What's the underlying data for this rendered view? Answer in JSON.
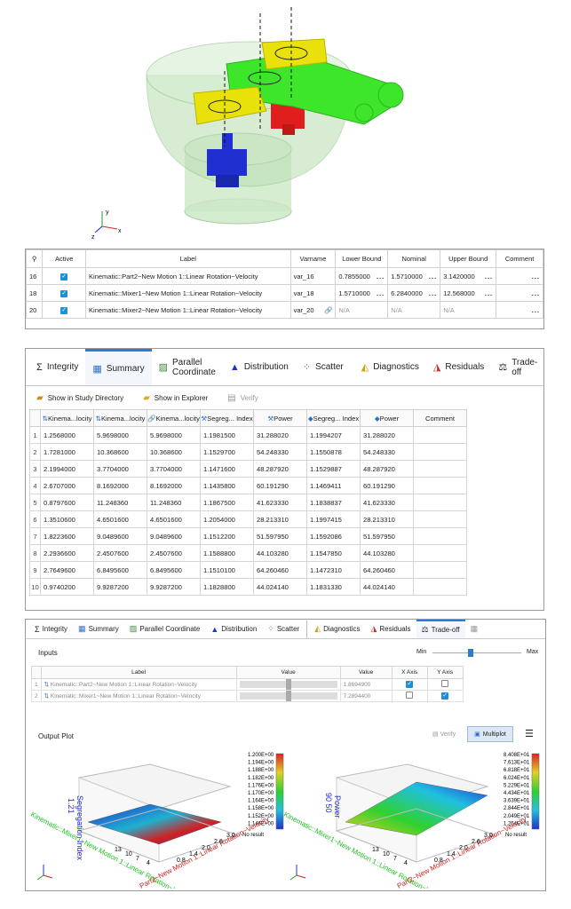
{
  "model": {
    "axis_labels": [
      "y",
      "x",
      "z"
    ],
    "colors": {
      "bowl": "#b9ddb0",
      "arm": "#3ee62b",
      "hub": "#e8e20a",
      "motor_top": "#e01e1e",
      "motor_bottom": "#1f2fd0"
    }
  },
  "vartable": {
    "headers": [
      "",
      "Active",
      "Label",
      "Varname",
      "Lower Bound",
      "Nominal",
      "Upper Bound",
      "Comment"
    ],
    "rows": [
      {
        "id": "16",
        "active": true,
        "label": "Kinematic::Part2~New Motion 1::Linear Rotation~Velocity",
        "varname": "var_16",
        "lower": "0.7855000",
        "nominal": "1.5710000",
        "upper": "3.1420000",
        "comment_dots": "..."
      },
      {
        "id": "18",
        "active": true,
        "label": "Kinematic::Mixer1~New Motion 1::Linear Rotation~Velocity",
        "varname": "var_18",
        "lower": "1.5710000",
        "nominal": "6.2840000",
        "upper": "12.568000",
        "comment_dots": "..."
      },
      {
        "id": "20",
        "active": true,
        "label": "Kinematic::Mixer2~New Motion 1::Linear Rotation~Velocity",
        "varname": "var_20",
        "lower": "N/A",
        "nominal": "N/A",
        "upper": "N/A",
        "comment_dots": "..."
      }
    ],
    "dots": "..."
  },
  "summary_panel": {
    "tabs": [
      {
        "label": "Integrity",
        "icon": "sigma-icon"
      },
      {
        "label": "Summary",
        "icon": "table-icon",
        "active": true
      },
      {
        "label": "Parallel Coordinate",
        "icon": "parallel-icon"
      },
      {
        "label": "Distribution",
        "icon": "distribution-icon"
      },
      {
        "label": "Scatter",
        "icon": "scatter-icon"
      },
      {
        "label": "Diagnostics",
        "icon": "diagnostics-icon"
      },
      {
        "label": "Residuals",
        "icon": "residuals-icon"
      },
      {
        "label": "Trade-off",
        "icon": "balance-icon"
      }
    ],
    "toolbar": {
      "show_dir": "Show in Study Directory",
      "show_explorer": "Show in Explorer",
      "verify": "Verify"
    },
    "headers": [
      "",
      "Kinema...locity",
      "Kinema...locity",
      "Kinema...locity",
      "Segreg... Index",
      "Power",
      "Segreg... Index",
      "Power",
      "Comment"
    ],
    "rows": [
      [
        "1",
        "1.2568000",
        "5.9698000",
        "5.9698000",
        "1.1981500",
        "31.288020",
        "1.1994207",
        "31.288020",
        ""
      ],
      [
        "2",
        "1.7281000",
        "10.368600",
        "10.368600",
        "1.1529700",
        "54.248330",
        "1.1550878",
        "54.248330",
        ""
      ],
      [
        "3",
        "2.1994000",
        "3.7704000",
        "3.7704000",
        "1.1471600",
        "48.287920",
        "1.1529887",
        "48.287920",
        ""
      ],
      [
        "4",
        "2.6707000",
        "8.1692000",
        "8.1692000",
        "1.1435800",
        "60.191290",
        "1.1469411",
        "60.191290",
        ""
      ],
      [
        "5",
        "0.8797600",
        "11.248360",
        "11.248360",
        "1.1867500",
        "41.623330",
        "1.1838837",
        "41.623330",
        ""
      ],
      [
        "6",
        "1.3510600",
        "4.6501600",
        "4.6501600",
        "1.2054000",
        "28.213310",
        "1.1997415",
        "28.213310",
        ""
      ],
      [
        "7",
        "1.8223600",
        "9.0489600",
        "9.0489600",
        "1.1512200",
        "51.597950",
        "1.1592086",
        "51.597950",
        ""
      ],
      [
        "8",
        "2.2936600",
        "2.4507600",
        "2.4507600",
        "1.1588800",
        "44.103280",
        "1.1547850",
        "44.103280",
        ""
      ],
      [
        "9",
        "2.7649600",
        "6.8495600",
        "6.8495600",
        "1.1510100",
        "64.260460",
        "1.1472310",
        "64.260460",
        ""
      ],
      [
        "10",
        "0.9740200",
        "9.9287200",
        "9.9287200",
        "1.1828800",
        "44.024140",
        "1.1831330",
        "44.024140",
        ""
      ]
    ]
  },
  "tradeoff_panel": {
    "tabs": [
      {
        "label": "Integrity",
        "icon": "sigma-icon"
      },
      {
        "label": "Summary",
        "icon": "table-icon"
      },
      {
        "label": "Parallel Coordinate",
        "icon": "parallel-icon"
      },
      {
        "label": "Distribution",
        "icon": "distribution-icon"
      },
      {
        "label": "Scatter",
        "icon": "scatter-icon"
      },
      {
        "label": "Diagnostics",
        "icon": "diagnostics-icon"
      },
      {
        "label": "Residuals",
        "icon": "residuals-icon"
      },
      {
        "label": "Trade-off",
        "icon": "balance-icon",
        "active": true
      }
    ],
    "inputs_title": "Inputs",
    "slider": {
      "min_label": "Min",
      "max_label": "Max",
      "position_fraction": 0.4
    },
    "input_headers": [
      "",
      "Label",
      "Value",
      "Value",
      "X Axis",
      "Y Axis"
    ],
    "inputs": [
      {
        "id": "1",
        "label": "Kinematic::Part2~New Motion 1::Linear Rotation~Velocity",
        "value": "1.8694900",
        "x_axis": true,
        "y_axis": false
      },
      {
        "id": "2",
        "label": "Kinematic::Mixer1~New Motion 1::Linear Rotation~Velocity",
        "value": "7.2894400",
        "x_axis": false,
        "y_axis": true
      }
    ],
    "output_title": "Output Plot",
    "verify": "Verify",
    "multiplot": "Multiplot"
  },
  "plots": {
    "left": {
      "zlabel": "Segregation Index",
      "ztick": "1.21",
      "xlabel": "Part2~New Motion 1::Linear Rotation~Velocity",
      "ylabel": "Kinematic::Mixer1~New Motion 1::Linear Rotation~Velocity",
      "xticks": [
        "0.8",
        "1.4",
        "2.0",
        "2.6",
        "3.0"
      ],
      "yticks": [
        "13",
        "10",
        "7",
        "4"
      ],
      "colorbar": [
        "1.200E+00",
        "1.194E+00",
        "1.188E+00",
        "1.182E+00",
        "1.176E+00",
        "1.170E+00",
        "1.164E+00",
        "1.158E+00",
        "1.152E+00",
        "1.146E+00"
      ],
      "colorbar_title": "No result"
    },
    "right": {
      "zlabel": "Power",
      "ztick": "90 50",
      "xlabel": "Part2~New Motion 1::Linear Rotation~Velocity",
      "ylabel": "Kinematic::Mixer1~New Motion 1::Linear Rotation~Velocity",
      "xticks": [
        "0.8",
        "1.4",
        "2.0",
        "2.6",
        "3.0"
      ],
      "yticks": [
        "13",
        "10",
        "7",
        "4"
      ],
      "colorbar": [
        "8.408E+01",
        "7.613E+01",
        "6.818E+01",
        "6.024E+01",
        "5.229E+01",
        "4.434E+01",
        "3.639E+01",
        "2.844E+01",
        "2.049E+01",
        "1.254E+01"
      ],
      "colorbar_title": "No result"
    }
  }
}
